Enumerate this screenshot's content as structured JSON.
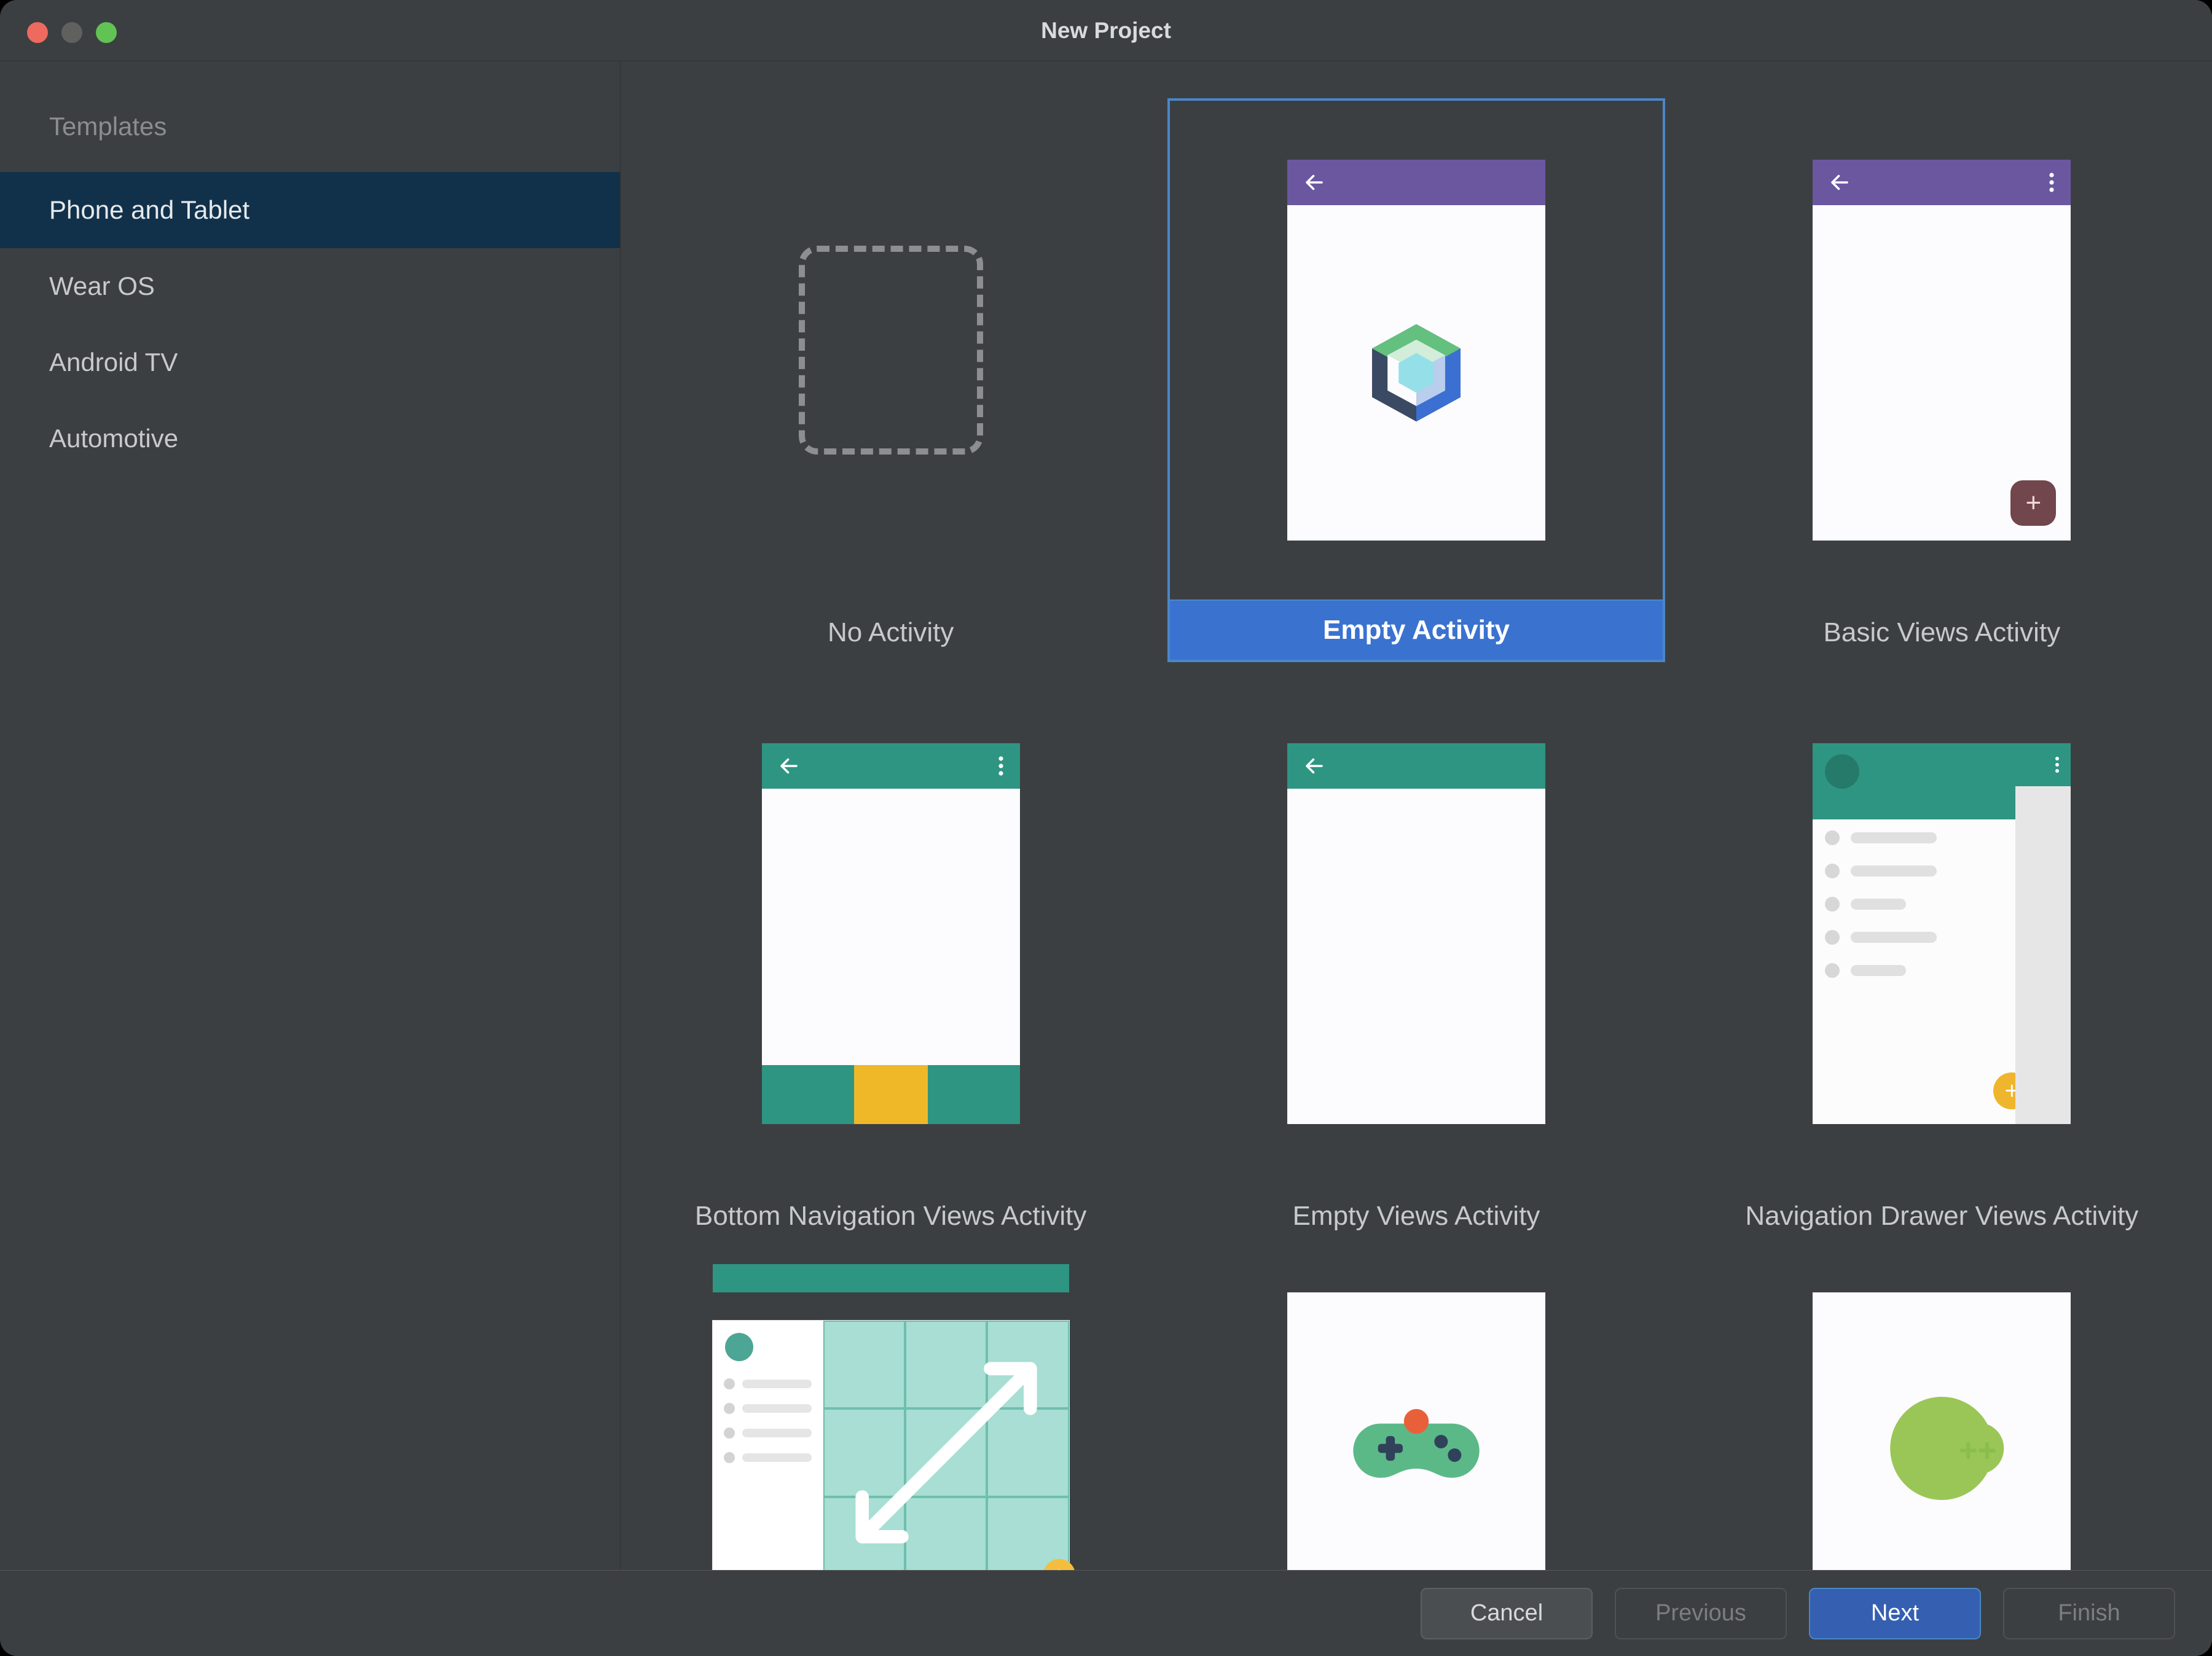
{
  "window": {
    "title": "New Project"
  },
  "sidebar": {
    "header": "Templates",
    "items": [
      {
        "label": "Phone and Tablet",
        "active": true
      },
      {
        "label": "Wear OS"
      },
      {
        "label": "Android TV"
      },
      {
        "label": "Automotive"
      }
    ]
  },
  "templates": [
    {
      "id": "no-activity",
      "label": "No Activity"
    },
    {
      "id": "empty-activity",
      "label": "Empty Activity",
      "selected": true
    },
    {
      "id": "basic-views-activity",
      "label": "Basic Views Activity"
    },
    {
      "id": "bottom-navigation-views-activity",
      "label": "Bottom Navigation Views Activity"
    },
    {
      "id": "empty-views-activity",
      "label": "Empty Views Activity"
    },
    {
      "id": "navigation-drawer-views-activity",
      "label": "Navigation Drawer Views Activity"
    },
    {
      "id": "responsive-views-activity",
      "label": ""
    },
    {
      "id": "game-activity",
      "label": ""
    },
    {
      "id": "native-cpp",
      "label": ""
    }
  ],
  "footer": {
    "cancel": "Cancel",
    "previous": "Previous",
    "next": "Next",
    "finish": "Finish"
  },
  "colors": {
    "accent_purple": "#6a57a0",
    "accent_teal": "#2e9582",
    "selection_blue": "#3a72d0",
    "cpp_green": "#88be49"
  }
}
